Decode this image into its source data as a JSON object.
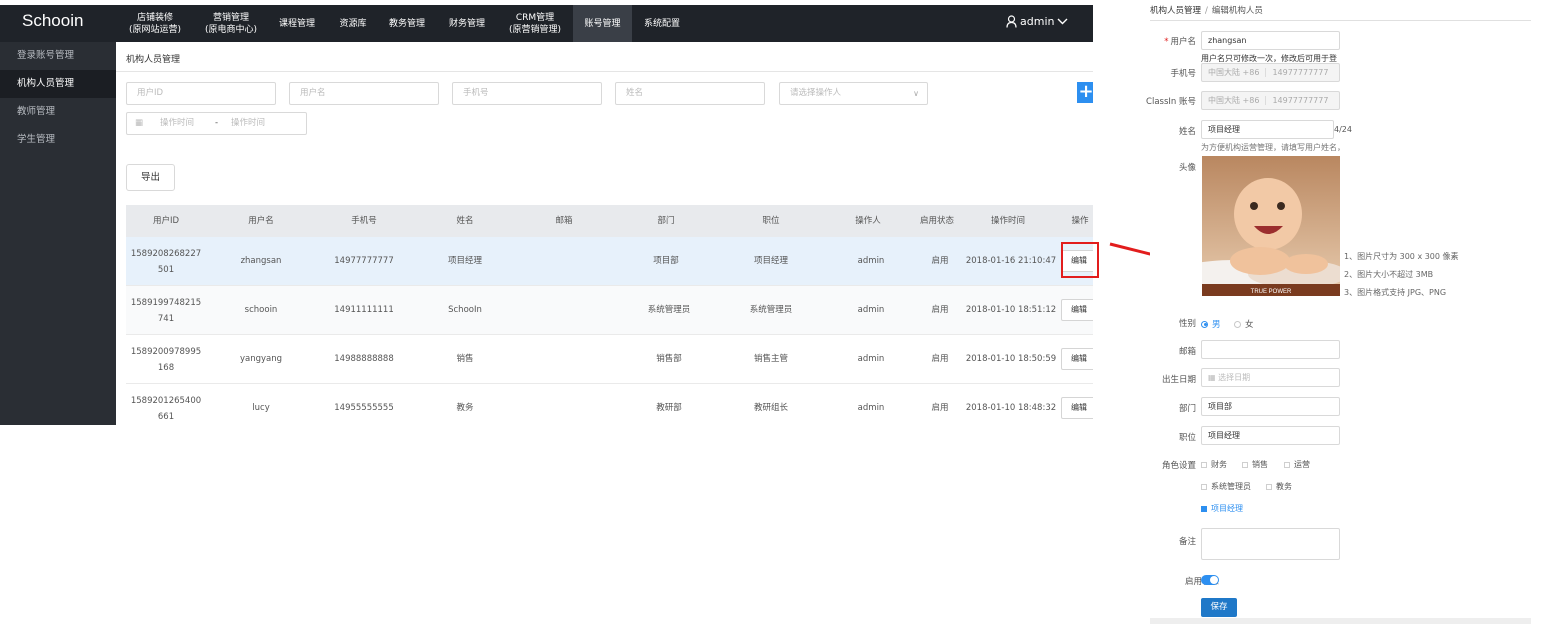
{
  "app": {
    "logo": "Schooin",
    "nav": [
      {
        "line1": "店铺装修",
        "line2": "(原网站运营)"
      },
      {
        "line1": "营销管理",
        "line2": "(原电商中心)"
      },
      {
        "line1": "课程管理",
        "line2": ""
      },
      {
        "line1": "资源库",
        "line2": ""
      },
      {
        "line1": "教务管理",
        "line2": ""
      },
      {
        "line1": "财务管理",
        "line2": ""
      },
      {
        "line1": "CRM管理",
        "line2": "(原营销管理)"
      },
      {
        "line1": "账号管理",
        "line2": ""
      },
      {
        "line1": "系统配置",
        "line2": ""
      }
    ],
    "active_nav": "账号管理",
    "user": "admin",
    "sidebar": [
      "登录账号管理",
      "机构人员管理",
      "教师管理",
      "学生管理"
    ],
    "breadcrumb": "机构人员管理",
    "filters": {
      "user_id": "用户ID",
      "username": "用户名",
      "phone": "手机号",
      "name": "姓名",
      "operator": "请选择操作人",
      "time_start": "操作时间",
      "time_sep": "-",
      "time_end": "操作时间"
    },
    "export_label": "导出",
    "add_label": "+",
    "table": {
      "headers": [
        "用户ID",
        "用户名",
        "手机号",
        "姓名",
        "邮箱",
        "部门",
        "职位",
        "操作人",
        "启用状态",
        "操作时间",
        "操作"
      ],
      "rows": [
        {
          "id": "1589208268227501",
          "username": "zhangsan",
          "phone": "14977777777",
          "name": "项目经理",
          "email": "",
          "dept": "项目部",
          "position": "项目经理",
          "operator": "admin",
          "status": "启用",
          "time": "2018-01-16 21:10:47",
          "action": "编辑"
        },
        {
          "id": "1589199748215741",
          "username": "schooin",
          "phone": "14911111111",
          "name": "SchooIn",
          "email": "",
          "dept": "系统管理员",
          "position": "系统管理员",
          "operator": "admin",
          "status": "启用",
          "time": "2018-01-10 18:51:12",
          "action": "编辑"
        },
        {
          "id": "1589200978995168",
          "username": "yangyang",
          "phone": "14988888888",
          "name": "销售",
          "email": "",
          "dept": "销售部",
          "position": "销售主管",
          "operator": "admin",
          "status": "启用",
          "time": "2018-01-10 18:50:59",
          "action": "编辑"
        },
        {
          "id": "1589201265400661",
          "username": "lucy",
          "phone": "14955555555",
          "name": "教务",
          "email": "",
          "dept": "教研部",
          "position": "教研组长",
          "operator": "admin",
          "status": "启用",
          "time": "2018-01-10 18:48:32",
          "action": "编辑"
        }
      ]
    }
  },
  "form": {
    "breadcrumb_parent": "机构人员管理",
    "breadcrumb_sep": "/",
    "breadcrumb_current": "编辑机构人员",
    "username_label": "用户名",
    "username_value": "zhangsan",
    "username_hint": "用户名只可修改一次，修改后可用于登",
    "phone_label": "手机号",
    "phone_prefix": "中国大陆 +86",
    "phone_value": "14977777777",
    "classin_label": "ClassIn 账号",
    "classin_prefix": "中国大陆 +86",
    "classin_value": "14977777777",
    "name_label": "姓名",
    "name_value": "项目经理",
    "name_counter": "4/24",
    "name_hint": "为方便机构运营管理，请填写用户姓名，",
    "avatar_label": "头像",
    "avatar_caption": "TRUE POWER",
    "avatar_notes": [
      "1、图片尺寸为 300 x 300 像素",
      "2、图片大小不超过 3MB",
      "3、图片格式支持 JPG、PNG"
    ],
    "gender_label": "性别",
    "gender_options": [
      "男",
      "女"
    ],
    "gender_selected": "男",
    "email_label": "邮箱",
    "email_value": "",
    "birth_label": "出生日期",
    "birth_placeholder": "选择日期",
    "dept_label": "部门",
    "dept_value": "项目部",
    "position_label": "职位",
    "position_value": "项目经理",
    "role_label": "角色设置",
    "roles": [
      "财务",
      "销售",
      "运营",
      "系统管理员",
      "教务",
      "项目经理"
    ],
    "roles_checked": [
      "项目经理"
    ],
    "remark_label": "备注",
    "status_label": "启用状态",
    "status_on": true,
    "save_label": "保存"
  },
  "colors": {
    "topbar": "#1f2329",
    "sidebar": "#2a2e34",
    "accent": "#2d8ff0",
    "highlight_box": "#e21d1d",
    "save_button": "#1f78c8"
  },
  "icons": [
    "user-icon",
    "chevron-down-icon",
    "calendar-icon",
    "plus-icon",
    "red-arrow-icon"
  ]
}
